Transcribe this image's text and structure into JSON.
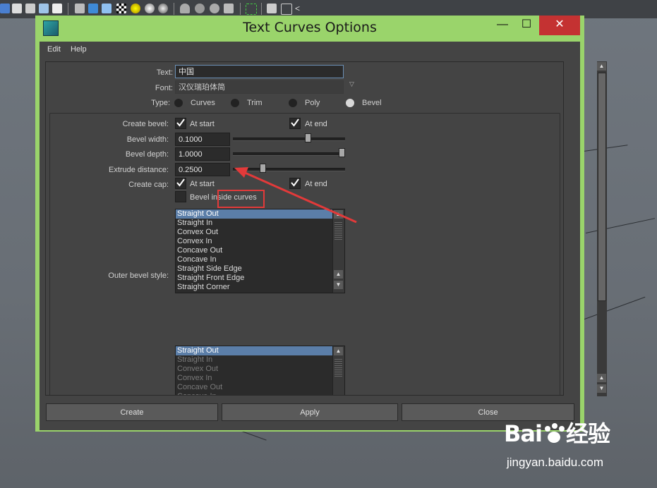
{
  "window": {
    "title": "Text Curves Options"
  },
  "menu": [
    "Edit",
    "Help"
  ],
  "text_field": {
    "label": "Text:",
    "value": "中国"
  },
  "font_field": {
    "label": "Font:",
    "value": "汉仪瑞珀体简"
  },
  "type": {
    "label": "Type:",
    "options": [
      "Curves",
      "Trim",
      "Poly",
      "Bevel"
    ],
    "selected": "Bevel"
  },
  "bevel": {
    "create_bevel_label": "Create bevel:",
    "at_start": "At start",
    "at_end": "At end",
    "width_label": "Bevel width:",
    "width_value": "0.1000",
    "width_fraction": 0.68,
    "depth_label": "Bevel depth:",
    "depth_value": "1.0000",
    "depth_fraction": 1.0,
    "extrude_label": "Extrude distance:",
    "extrude_value": "0.2500",
    "extrude_fraction": 0.25,
    "cap_label": "Create cap:",
    "inside_curves": "Bevel inside curves",
    "outer_style_label": "Outer bevel style:"
  },
  "outer_styles": [
    "Straight Out",
    "Straight In",
    "Convex Out",
    "Convex In",
    "Concave Out",
    "Concave In",
    "Straight Side Edge",
    "Straight Front Edge",
    "Straight Corner"
  ],
  "inner_styles": [
    "Straight Out",
    "Straight In",
    "Convex Out",
    "Convex In",
    "Concave Out",
    "Concave In"
  ],
  "buttons": {
    "create": "Create",
    "apply": "Apply",
    "close": "Close"
  },
  "window_controls": {
    "minimize": "—",
    "maximize": "☐",
    "close": "✕"
  },
  "watermark": {
    "brand": "Bai",
    "brand2": "经验",
    "url": "jingyan.baidu.com"
  },
  "colors": {
    "frame": "#9ad46b",
    "selection": "#5b7ea8",
    "highlight": "#e23a3a"
  }
}
